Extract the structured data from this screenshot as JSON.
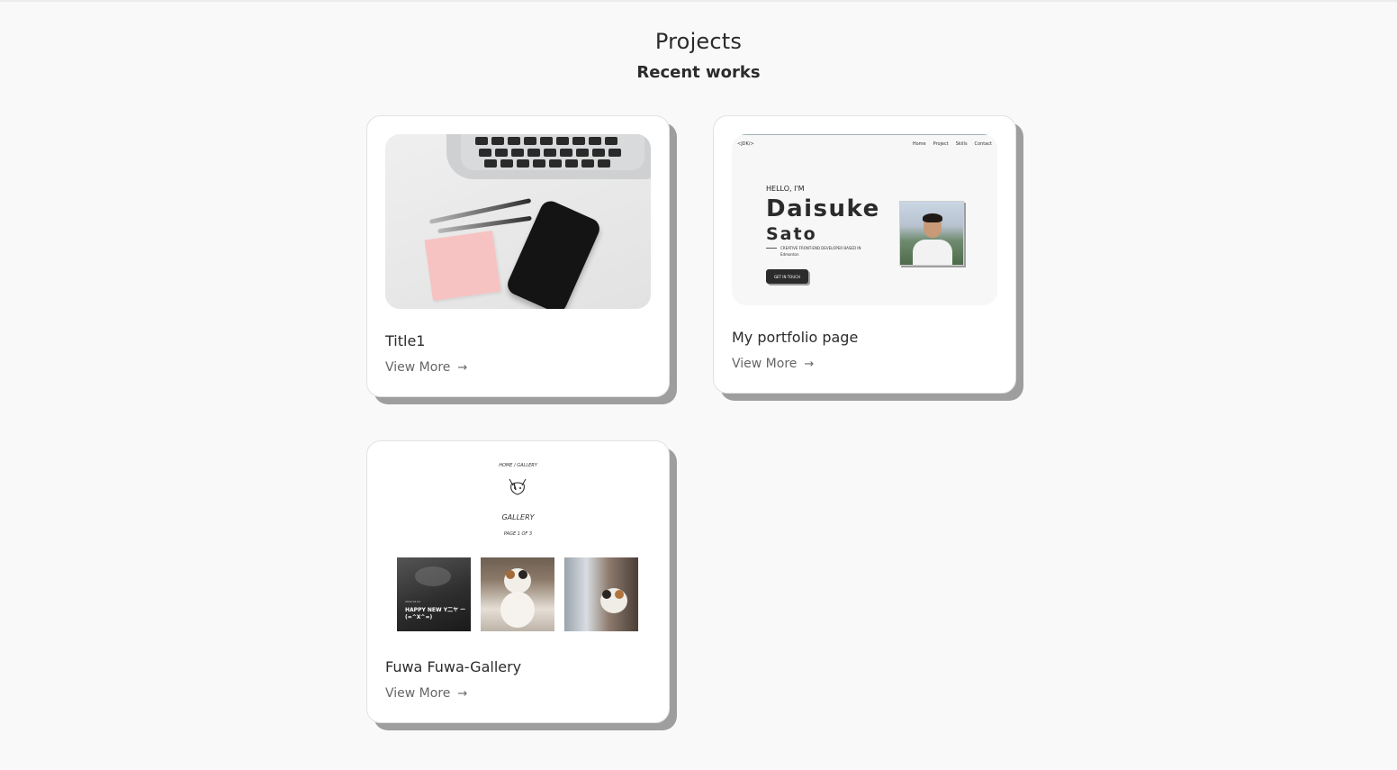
{
  "section": {
    "title": "Projects",
    "subtitle": "Recent works"
  },
  "projects": [
    {
      "title": "Title1",
      "link_label": "View More",
      "link_icon": "arrow-right-icon"
    },
    {
      "title": "My portfolio page",
      "link_label": "View More",
      "link_icon": "arrow-right-icon",
      "preview": {
        "logo": "<JDK/>",
        "nav": [
          "Home",
          "Project",
          "Skills",
          "Contact"
        ],
        "greeting": "HELLO, I'M",
        "first_name": "Daisuke",
        "last_name": "Sato",
        "description": "CREATIVE FRONT-END DEVELOPER BASED IN Edmonton",
        "button": "GET IN TOUCH"
      }
    },
    {
      "title": "Fuwa Fuwa-Gallery",
      "link_label": "View More",
      "link_icon": "arrow-right-icon",
      "preview": {
        "nav": "HOME / GALLERY",
        "heading": "GALLERY",
        "page": "PAGE 1 OF 3",
        "caption_small": "2024.01.01",
        "caption": "HAPPY NEW Y二ヤ ー (=^X^=)"
      }
    }
  ],
  "colors": {
    "background": "#f9f9f9",
    "card": "#ffffff",
    "card_shadow": "#9e9e9e",
    "text": "#2b2b2b",
    "muted": "#666666"
  }
}
